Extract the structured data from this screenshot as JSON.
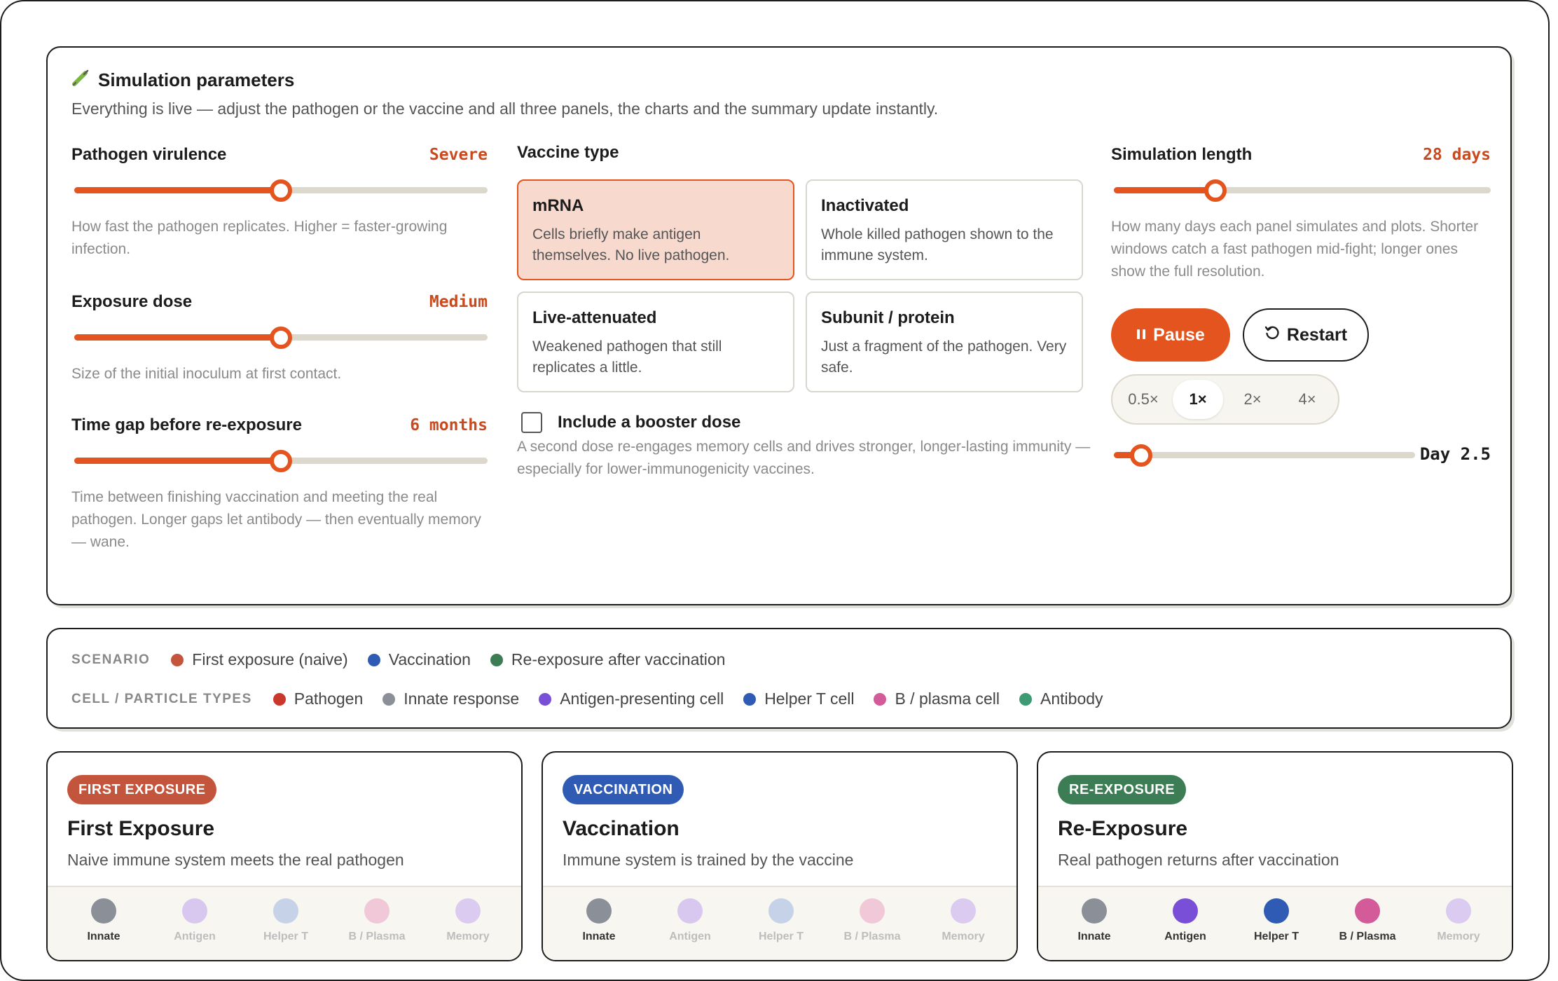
{
  "params": {
    "title": "Simulation parameters",
    "subtitle": "Everything is live — adjust the pathogen or the vaccine and all three panels, the charts and the summary update instantly.",
    "virulence": {
      "label": "Pathogen virulence",
      "value": "Severe",
      "level": 0.5,
      "help": "How fast the pathogen replicates. Higher = faster-growing infection."
    },
    "dose": {
      "label": "Exposure dose",
      "value": "Medium",
      "level": 0.5,
      "help": "Size of the initial inoculum at first contact."
    },
    "gap": {
      "label": "Time gap before re-exposure",
      "value": "6 months",
      "level": 0.5,
      "help": "Time between finishing vaccination and meeting the real pathogen. Longer gaps let antibody — then eventually memory — wane."
    },
    "vaccine": {
      "label": "Vaccine type",
      "options": [
        {
          "name": "mRNA",
          "desc": "Cells briefly make antigen themselves. No live pathogen.",
          "selected": true
        },
        {
          "name": "Inactivated",
          "desc": "Whole killed pathogen shown to the immune system.",
          "selected": false
        },
        {
          "name": "Live-attenuated",
          "desc": "Weakened pathogen that still replicates a little.",
          "selected": false
        },
        {
          "name": "Subunit / protein",
          "desc": "Just a fragment of the pathogen. Very safe.",
          "selected": false
        }
      ]
    },
    "booster": {
      "label": "Include a booster dose",
      "checked": false,
      "help": "A second dose re-engages memory cells and drives stronger, longer-lasting immunity — especially for lower-immunogenicity vaccines."
    },
    "length": {
      "label": "Simulation length",
      "value": "28 days",
      "level": 0.27,
      "help": "How many days each panel simulates and plots. Shorter windows catch a fast pathogen mid-fight; longer ones show the full resolution."
    },
    "pause_label": "Pause",
    "restart_label": "Restart",
    "speeds": [
      "0.5×",
      "1×",
      "2×",
      "4×"
    ],
    "speed_selected": "1×",
    "day_label": "Day 2.5",
    "day_level": 0.09
  },
  "legend": {
    "scenario_head": "SCENARIO",
    "scenarios": [
      {
        "label": "First exposure (naive)",
        "color": "#c4553d"
      },
      {
        "label": "Vaccination",
        "color": "#2f5bb5"
      },
      {
        "label": "Re-exposure after vaccination",
        "color": "#3d7d55"
      }
    ],
    "cells_head": "CELL / PARTICLE TYPES",
    "cells": [
      {
        "label": "Pathogen",
        "color": "#c9382b"
      },
      {
        "label": "Innate response",
        "color": "#8a8f98"
      },
      {
        "label": "Antigen-presenting cell",
        "color": "#7a4fd8"
      },
      {
        "label": "Helper T cell",
        "color": "#2f5bb5"
      },
      {
        "label": "B / plasma cell",
        "color": "#d35b9a"
      },
      {
        "label": "Antibody",
        "color": "#3d9a72"
      }
    ]
  },
  "scenarios": [
    {
      "badge": "FIRST EXPOSURE",
      "color": "#c4553d",
      "title": "First Exposure",
      "subtitle": "Naive immune system meets the real pathogen",
      "cells": [
        {
          "label": "Innate",
          "color": "#8a8f98",
          "active": true
        },
        {
          "label": "Antigen",
          "color": "#d8c8f0",
          "active": false
        },
        {
          "label": "Helper T",
          "color": "#c6d2e8",
          "active": false
        },
        {
          "label": "B / Plasma",
          "color": "#f0c8d8",
          "active": false
        },
        {
          "label": "Memory",
          "color": "#dccbf0",
          "active": false
        }
      ]
    },
    {
      "badge": "VACCINATION",
      "color": "#2f5bb5",
      "title": "Vaccination",
      "subtitle": "Immune system is trained by the vaccine",
      "cells": [
        {
          "label": "Innate",
          "color": "#8a8f98",
          "active": true
        },
        {
          "label": "Antigen",
          "color": "#d8c8f0",
          "active": false
        },
        {
          "label": "Helper T",
          "color": "#c6d2e8",
          "active": false
        },
        {
          "label": "B / Plasma",
          "color": "#f0c8d8",
          "active": false
        },
        {
          "label": "Memory",
          "color": "#dccbf0",
          "active": false
        }
      ]
    },
    {
      "badge": "RE-EXPOSURE",
      "color": "#3d7d55",
      "title": "Re-Exposure",
      "subtitle": "Real pathogen returns after vaccination",
      "cells": [
        {
          "label": "Innate",
          "color": "#8a8f98",
          "active": true
        },
        {
          "label": "Antigen",
          "color": "#7a4fd8",
          "active": true
        },
        {
          "label": "Helper T",
          "color": "#2f5bb5",
          "active": true
        },
        {
          "label": "B / Plasma",
          "color": "#d35b9a",
          "active": true
        },
        {
          "label": "Memory",
          "color": "#dccbf0",
          "active": false
        }
      ]
    }
  ]
}
